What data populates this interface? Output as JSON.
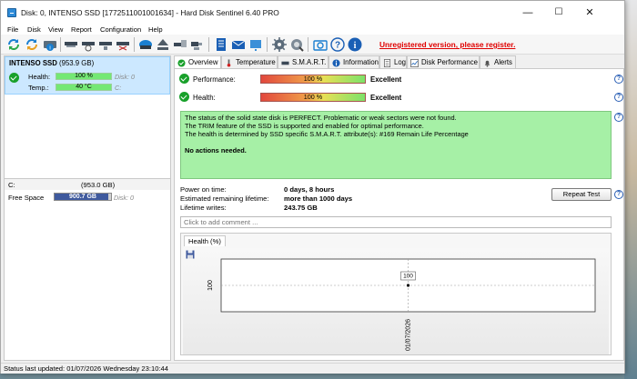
{
  "window": {
    "title": "Disk: 0, INTENSO SSD [1772511001001634]  -  Hard Disk Sentinel 6.40 PRO",
    "minimize": "—",
    "maximize": "☐",
    "close": "✕"
  },
  "menu": [
    "File",
    "Disk",
    "View",
    "Report",
    "Configuration",
    "Help"
  ],
  "toolbar": {
    "icons": [
      "refresh-icon",
      "refresh-all-icon",
      "info-disk-icon",
      "disk-icon",
      "disk-test-icon",
      "disk-settings-icon",
      "disk-erase-icon",
      "drive-scan-icon",
      "eject-icon",
      "network-disk-icon",
      "usb-disk-icon",
      "report-icon",
      "email-icon",
      "export-icon",
      "gear-icon",
      "settings-icon",
      "camera-icon",
      "help-icon",
      "info-icon"
    ],
    "register_link": "Unregistered version, please register."
  },
  "left_panel": {
    "disk_name": "INTENSO SSD",
    "disk_size": "(953.9 GB)",
    "health_label": "Health:",
    "health_value": "100 %",
    "health_disk": "Disk: 0",
    "temp_label": "Temp.:",
    "temp_value": "40 °C",
    "temp_drive": "C:",
    "volume_letter": "C:",
    "volume_size": "(953.0 GB)",
    "free_label": "Free Space",
    "free_value": "900.7 GB",
    "free_disk": "Disk: 0",
    "free_fraction": 0.945
  },
  "tabs": [
    {
      "label": "Overview",
      "icon": "check-icon"
    },
    {
      "label": "Temperature",
      "icon": "thermometer-icon"
    },
    {
      "label": "S.M.A.R.T.",
      "icon": "smart-icon"
    },
    {
      "label": "Information",
      "icon": "info-icon"
    },
    {
      "label": "Log",
      "icon": "log-icon"
    },
    {
      "label": "Disk Performance",
      "icon": "performance-icon"
    },
    {
      "label": "Alerts",
      "icon": "bell-icon"
    }
  ],
  "overview": {
    "performance_label": "Performance:",
    "performance_value": "100 %",
    "performance_rating": "Excellent",
    "health_label": "Health:",
    "health_value": "100 %",
    "health_rating": "Excellent",
    "status_lines": [
      "The status of the solid state disk is PERFECT. Problematic or weak sectors were not found.",
      "The TRIM feature of the SSD is supported and enabled for optimal performance.",
      "The health is determined by SSD specific S.M.A.R.T. attribute(s):  #169 Remain Life Percentage"
    ],
    "status_action": "No actions needed.",
    "power_on_label": "Power on time:",
    "power_on_value": "0 days, 8 hours",
    "lifetime_label": "Estimated remaining lifetime:",
    "lifetime_value": "more than 1000 days",
    "writes_label": "Lifetime writes:",
    "writes_value": "243.75 GB",
    "repeat_button": "Repeat Test",
    "comment_placeholder": "Click to add comment ..."
  },
  "chart_data": {
    "type": "line",
    "title": "Health (%)",
    "x": [
      "01/07/2026"
    ],
    "series": [
      {
        "values": [
          100
        ]
      }
    ],
    "y_tick_labels": [
      "100"
    ],
    "data_labels": [
      "100"
    ],
    "grid": true
  },
  "statusbar": {
    "text": "Status last updated: 01/07/2026 Wednesday 23:10:44"
  }
}
